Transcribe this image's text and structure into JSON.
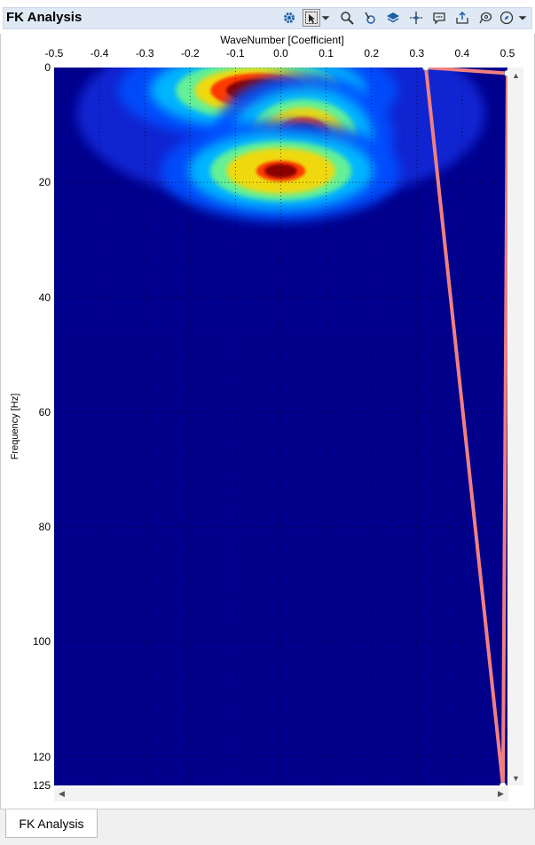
{
  "window": {
    "title": "FK Analysis"
  },
  "toolbar": {
    "icons": [
      "settings-icon",
      "select-cursor-icon",
      "dropdown-arrow-icon",
      "zoom-icon",
      "pick-icon",
      "layers-icon",
      "crosshair-icon",
      "comment-icon",
      "export-icon",
      "lasso-icon",
      "compass-icon",
      "dropdown-arrow-icon"
    ]
  },
  "chart_data": {
    "type": "heatmap",
    "xlabel": "WaveNumber [Coefficient]",
    "ylabel": "Frequency [Hz]",
    "x_ticks": [
      "-0.5",
      "-0.4",
      "-0.3",
      "-0.2",
      "-0.1",
      "0.0",
      "0.1",
      "0.2",
      "0.3",
      "0.4",
      "0.5"
    ],
    "x_tick_values": [
      -0.5,
      -0.4,
      -0.3,
      -0.2,
      -0.1,
      0.0,
      0.1,
      0.2,
      0.3,
      0.4,
      0.5
    ],
    "y_ticks": [
      "0",
      "20",
      "40",
      "60",
      "80",
      "100",
      "120",
      "125"
    ],
    "y_tick_values": [
      0,
      20,
      40,
      60,
      80,
      100,
      120,
      125
    ],
    "xlim": [
      -0.5,
      0.5
    ],
    "ylim": [
      0,
      125
    ],
    "y_inverted": true,
    "colormap": "jet",
    "grid": true,
    "high_energy_regions": [
      {
        "k_center": -0.05,
        "f_center": 4,
        "k_width": 0.14,
        "f_width": 4,
        "level": 1.0
      },
      {
        "k_center": 0.05,
        "f_center": 12,
        "k_width": 0.09,
        "f_width": 5,
        "level": 0.9
      },
      {
        "k_center": 0.0,
        "f_center": 18,
        "k_width": 0.12,
        "f_width": 4,
        "level": 0.6
      }
    ],
    "filter_polygon": {
      "color": "#f08080",
      "points": [
        [
          0.32,
          0
        ],
        [
          0.5,
          1
        ],
        [
          0.49,
          125
        ],
        [
          0.32,
          0
        ]
      ]
    }
  },
  "tabs": [
    {
      "label": "FK Analysis"
    }
  ],
  "colors": {
    "background": "#00008b",
    "title_bar": "#dfe9f5",
    "filter_line": "#f08080"
  }
}
